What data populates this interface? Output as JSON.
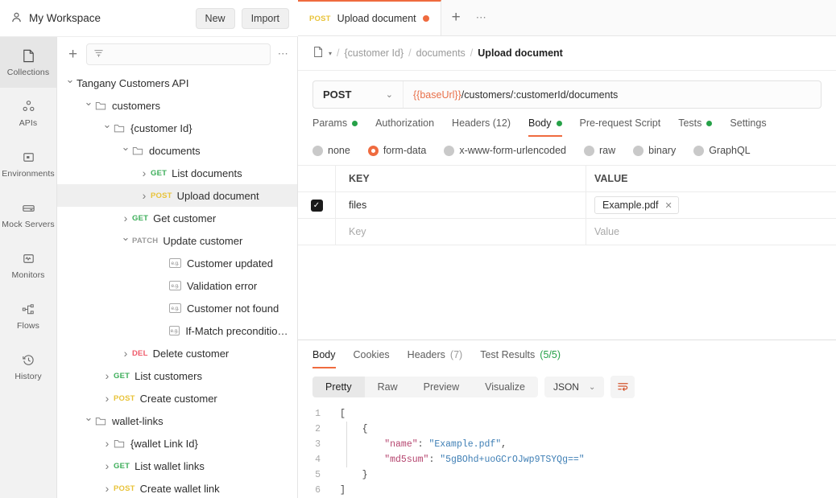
{
  "workspace": {
    "title": "My Workspace",
    "user_icon": "person-icon",
    "new_label": "New",
    "import_label": "Import"
  },
  "rail": {
    "items": [
      {
        "label": "Collections",
        "icon": "collections-icon",
        "active": true
      },
      {
        "label": "APIs",
        "icon": "apis-icon",
        "active": false
      },
      {
        "label": "Environments",
        "icon": "environments-icon",
        "active": false
      },
      {
        "label": "Mock Servers",
        "icon": "mock-servers-icon",
        "active": false
      },
      {
        "label": "Monitors",
        "icon": "monitors-icon",
        "active": false
      },
      {
        "label": "Flows",
        "icon": "flows-icon",
        "active": false
      },
      {
        "label": "History",
        "icon": "history-icon",
        "active": false
      }
    ]
  },
  "sidebar": {
    "add_label": "+",
    "filter_placeholder": "",
    "filter_icon": "filter-icon",
    "more_label": "⋯",
    "tree": [
      {
        "label": "Tangany Customers API",
        "indent": 0,
        "caret": "down",
        "kind": "collection"
      },
      {
        "label": "customers",
        "indent": 1,
        "caret": "down",
        "kind": "folder"
      },
      {
        "label": "{customer Id}",
        "indent": 2,
        "caret": "down",
        "kind": "folder"
      },
      {
        "label": "documents",
        "indent": 3,
        "caret": "down",
        "kind": "folder"
      },
      {
        "label": "List documents",
        "indent": 4,
        "caret": "right",
        "kind": "request",
        "method": "GET"
      },
      {
        "label": "Upload document",
        "indent": 4,
        "caret": "right",
        "kind": "request",
        "method": "POST",
        "selected": true
      },
      {
        "label": "Get customer",
        "indent": 3,
        "caret": "right",
        "kind": "request",
        "method": "GET"
      },
      {
        "label": "Update customer",
        "indent": 3,
        "caret": "down",
        "kind": "request",
        "method": "PATCH"
      },
      {
        "label": "Customer updated",
        "indent": 5,
        "caret": "blank",
        "kind": "example"
      },
      {
        "label": "Validation error",
        "indent": 5,
        "caret": "blank",
        "kind": "example"
      },
      {
        "label": "Customer not found",
        "indent": 5,
        "caret": "blank",
        "kind": "example"
      },
      {
        "label": "If-Match precondition fail...",
        "indent": 5,
        "caret": "blank",
        "kind": "example"
      },
      {
        "label": "Delete customer",
        "indent": 3,
        "caret": "right",
        "kind": "request",
        "method": "DEL"
      },
      {
        "label": "List customers",
        "indent": 2,
        "caret": "right",
        "kind": "request",
        "method": "GET"
      },
      {
        "label": "Create customer",
        "indent": 2,
        "caret": "right",
        "kind": "request",
        "method": "POST"
      },
      {
        "label": "wallet-links",
        "indent": 1,
        "caret": "down",
        "kind": "folder"
      },
      {
        "label": "{wallet Link Id}",
        "indent": 2,
        "caret": "right",
        "kind": "folder"
      },
      {
        "label": "List wallet links",
        "indent": 2,
        "caret": "right",
        "kind": "request",
        "method": "GET"
      },
      {
        "label": "Create wallet link",
        "indent": 2,
        "caret": "right",
        "kind": "request",
        "method": "POST"
      }
    ]
  },
  "tabbar": {
    "tabs": [
      {
        "method": "POST",
        "name": "Upload document",
        "unsaved": true
      }
    ],
    "new_tab_label": "+",
    "more_label": "⋯"
  },
  "breadcrumb": {
    "collection_icon": "collection-icon",
    "caret": "▾",
    "items": [
      "{customer Id}",
      "documents"
    ],
    "current": "Upload document",
    "separator": "/"
  },
  "request": {
    "method": "POST",
    "method_caret": "⌄",
    "url_variable": "{{baseUrl}}",
    "url_path": "/customers/:customerId/documents",
    "tabs": [
      {
        "label": "Params",
        "dot": true,
        "active": false
      },
      {
        "label": "Authorization",
        "dot": false,
        "active": false
      },
      {
        "label": "Headers (12)",
        "dot": false,
        "active": false
      },
      {
        "label": "Body",
        "dot": true,
        "active": true
      },
      {
        "label": "Pre-request Script",
        "dot": false,
        "active": false
      },
      {
        "label": "Tests",
        "dot": true,
        "active": false
      },
      {
        "label": "Settings",
        "dot": false,
        "active": false
      }
    ],
    "body_types": [
      {
        "label": "none",
        "selected": false
      },
      {
        "label": "form-data",
        "selected": true
      },
      {
        "label": "x-www-form-urlencoded",
        "selected": false
      },
      {
        "label": "raw",
        "selected": false
      },
      {
        "label": "binary",
        "selected": false
      },
      {
        "label": "GraphQL",
        "selected": false
      }
    ],
    "form_data": {
      "col_key": "KEY",
      "col_value": "VALUE",
      "rows": [
        {
          "checked": true,
          "key": "files",
          "value": "Example.pdf",
          "is_file": true
        }
      ],
      "placeholder_key": "Key",
      "placeholder_value": "Value"
    }
  },
  "response": {
    "tabs": [
      {
        "label": "Body",
        "count": "",
        "active": true
      },
      {
        "label": "Cookies",
        "count": "",
        "active": false
      },
      {
        "label": "Headers",
        "count": "(7)",
        "active": false
      },
      {
        "label": "Test Results",
        "count": "(5/5)",
        "active": false
      }
    ],
    "view_modes": [
      {
        "label": "Pretty",
        "active": true
      },
      {
        "label": "Raw",
        "active": false
      },
      {
        "label": "Preview",
        "active": false
      },
      {
        "label": "Visualize",
        "active": false
      }
    ],
    "format": "JSON",
    "format_caret": "⌄",
    "wrap_icon": "word-wrap-icon",
    "body_lines": [
      {
        "n": "1",
        "tokens": [
          {
            "t": "[",
            "c": "p"
          }
        ]
      },
      {
        "n": "2",
        "tokens": [
          {
            "t": "    {",
            "c": "p"
          }
        ]
      },
      {
        "n": "3",
        "tokens": [
          {
            "t": "        ",
            "c": "p"
          },
          {
            "t": "\"name\"",
            "c": "k"
          },
          {
            "t": ": ",
            "c": "p"
          },
          {
            "t": "\"Example.pdf\"",
            "c": "s"
          },
          {
            "t": ",",
            "c": "p"
          }
        ]
      },
      {
        "n": "4",
        "tokens": [
          {
            "t": "        ",
            "c": "p"
          },
          {
            "t": "\"md5sum\"",
            "c": "k"
          },
          {
            "t": ": ",
            "c": "p"
          },
          {
            "t": "\"5gBOhd+uoGCrOJwp9TSYQg==\"",
            "c": "s"
          }
        ]
      },
      {
        "n": "5",
        "tokens": [
          {
            "t": "    }",
            "c": "p"
          }
        ]
      },
      {
        "n": "6",
        "tokens": [
          {
            "t": "]",
            "c": "p"
          }
        ]
      }
    ]
  },
  "colors": {
    "accent": "#ef6b3f",
    "get": "#3dae5a",
    "post": "#e8c33a",
    "patch": "#9b9b9b",
    "delete": "#ef5b6b",
    "status_green": "#26a148",
    "variable": "#e8704a"
  }
}
